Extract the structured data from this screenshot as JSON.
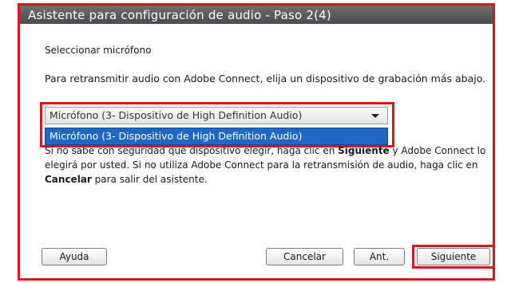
{
  "dialog": {
    "title": "Asistente para configuración de audio - Paso 2(4)"
  },
  "section": {
    "label": "Seleccionar micrófono"
  },
  "instructions": "Para retransmitir audio con Adobe Connect, elija un dispositivo de grabación más abajo.",
  "microphone_select": {
    "selected_value": "Micrófono (3- Dispositivo de High Definition Audio)",
    "options": [
      "Micrófono (3- Dispositivo de High Definition Audio)"
    ]
  },
  "help_text": {
    "part1": "Si no sabe con seguridad qué dispositivo elegir, haga clic en ",
    "bold1": "Siguiente",
    "part2": " y Adobe Connect lo elegirá por usted. Si no utiliza Adobe Connect para la retransmisión de audio, haga clic en ",
    "bold2": "Cancelar",
    "part3": " para salir del asistente."
  },
  "buttons": {
    "help": "Ayuda",
    "cancel": "Cancelar",
    "previous": "Ant.",
    "next": "Siguiente"
  },
  "colors": {
    "highlight": "#d81818",
    "titlebar": "#5a5a5a",
    "selection": "#1f67c2"
  }
}
